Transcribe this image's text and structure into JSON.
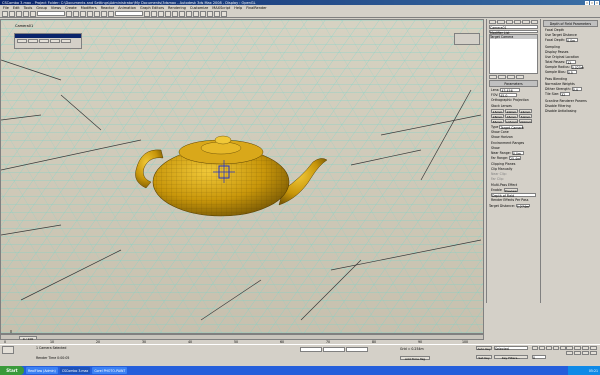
{
  "window": {
    "app_name": "CSCombo 3.max",
    "title": "- Project Folder: C:\\Documents and Settings\\Administrator\\My Documents\\3dsmax",
    "product": "- Autodesk 3ds Max 2008",
    "viewport_mode": "- Display : OpenGL"
  },
  "menu": [
    "File",
    "Edit",
    "Tools",
    "Group",
    "Views",
    "Create",
    "Modifiers",
    "Reactor",
    "Animation",
    "Graph Editors",
    "Rendering",
    "Customize",
    "MAXScript",
    "Help",
    "FinalRender"
  ],
  "viewport": {
    "label": "Camera01"
  },
  "command_panel": {
    "object_name": "Camera01",
    "modifier_list": "Modifier List",
    "stack_item": "Target Camera",
    "parameters_header": "Parameters",
    "lens_label": "Lens:",
    "lens_value": "43.456",
    "fov_label": "FOV:",
    "fov_value": "45.0",
    "ortho": "Orthographic Projection",
    "stock_lenses_header": "Stock Lenses",
    "stock_lenses": [
      "15mm",
      "20mm",
      "24mm",
      "28mm",
      "35mm",
      "50mm",
      "85mm",
      "135mm",
      "200mm"
    ],
    "type_label": "Type",
    "type_value": "Target Camera",
    "show_cone": "Show Cone",
    "show_horizon": "Show Horizon",
    "env_ranges_header": "Environment Ranges",
    "env_show": "Show",
    "near_range": "Near Range:",
    "near_value": "0.0m",
    "far_range": "Far Range:",
    "far_value": "25.4m",
    "clipping_header": "Clipping Planes",
    "clip_manually": "Clip Manually",
    "near_clip": "Near Clip:",
    "far_clip": "Far Clip:",
    "multipass_header": "Multi-Pass Effect",
    "enable": "Enable",
    "preview": "Preview",
    "effect_value": "Depth of Field",
    "render_effects": "Render Effects Per Pass",
    "target_distance_label": "Target Distance:",
    "target_distance_value": "1.274m"
  },
  "dof_panel": {
    "header": "Depth of Field Parameters",
    "focal_depth_header": "Focal Depth",
    "use_target_distance": "Use Target Distance",
    "focal_depth_label": "Focal Depth:",
    "focal_depth_value": "0.0m",
    "sampling_header": "Sampling",
    "display_passes": "Display Passes",
    "use_original_location": "Use Original Location",
    "total_passes_label": "Total Passes:",
    "total_passes_value": "12",
    "sample_radius_label": "Sample Radius:",
    "sample_radius_value": "0.025m",
    "sample_bias_label": "Sample Bias:",
    "sample_bias_value": "0.5",
    "pass_blending_header": "Pass Blending",
    "normalize_weights": "Normalize Weights",
    "dither_strength_label": "Dither Strength:",
    "dither_strength_value": "0.4",
    "tile_size_label": "Tile Size:",
    "tile_size_value": "32",
    "scanline_header": "Scanline Renderer Params",
    "disable_filtering": "Disable Filtering",
    "disable_antialiasing": "Disable Antialiasing"
  },
  "timeline": {
    "slider": "0 / 100",
    "ticks": [
      "0",
      "10",
      "20",
      "30",
      "40",
      "50",
      "60",
      "70",
      "80",
      "90",
      "100"
    ]
  },
  "status": {
    "selection": "1 Camera Selected",
    "hint": "Render Time 0:00:05",
    "grid": "Grid = 0.254m",
    "auto_key": "Auto Key",
    "selected": "Selected",
    "set_key": "Set Key",
    "key_filters": "Key Filters...",
    "add_time_tag": "Add Time Tag",
    "frame": "0"
  },
  "taskbar": {
    "start": "Start",
    "items": [
      "RealFlow (Admin)",
      "CSCombo 3.max",
      "Corel PHOTO-PAINT"
    ],
    "clock": "05:21"
  }
}
